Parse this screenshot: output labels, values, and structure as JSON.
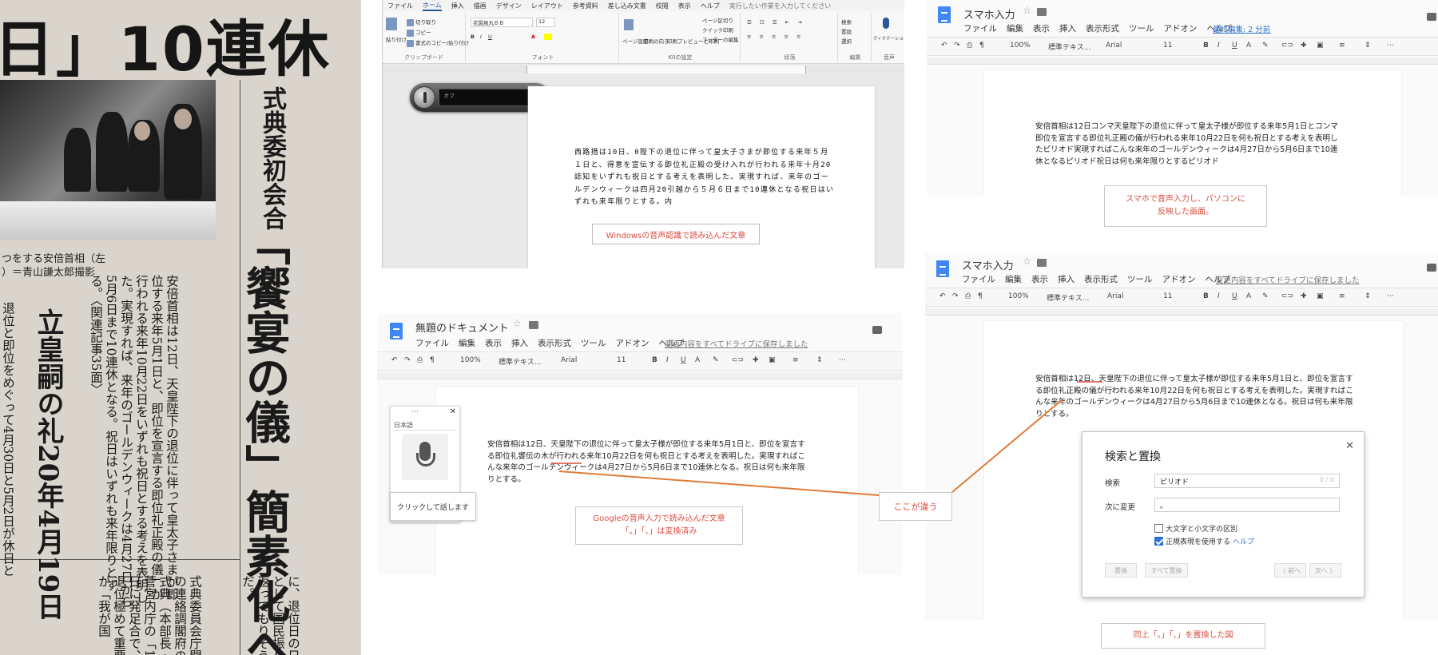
{
  "newspaper": {
    "headline": "日」10連休",
    "subheadline": "式典委初会合",
    "big_headline": "「饗宴の儀」簡素化へ",
    "section_label": "立皇嗣の礼20年4月19日",
    "photo_caption": "つをする安倍首相（左\n）＝青山謙太郎撮影",
    "body_text_a": "安倍首相は12日、天皇陛下の退位に伴って皇太子さまが即位する来年5月1日と、即位を宣言する即位礼正殿の儀」が行われる来年10月22日をいずれも祝日とする考えを表明した。実現すれば、来年のゴールデンウィークは4月27日から5月6日まで10連休となる。祝日はいずれも来年限りとする。〈関連記事35面〉",
    "body_text_b": "退位と即位をめぐって4月30日と5月2日が休日と",
    "body_text_c": "式典委員会庁間の連絡調閣府の式典（本部長・菅宮内庁の「12日に発足合で、退位極めて重要が「我が国",
    "body_text_d": "に、退位日の日として国民振り返ってもりそうだ。"
  },
  "word": {
    "menu": [
      "ファイル",
      "ホーム",
      "挿入",
      "描画",
      "デザイン",
      "レイアウト",
      "参考資料",
      "差し込み文書",
      "校閲",
      "表示",
      "ヘルプ",
      "実行したい作業を入力してください"
    ],
    "active_tab": "ホーム",
    "ribbon": {
      "clipboard": {
        "paste": "貼り付け",
        "cut": "切り取り",
        "copy": "コピー",
        "format": "書式のコピー/貼り付け",
        "label": "クリップボード"
      },
      "font": {
        "name": "花園風丸ＢＢ",
        "size": "12",
        "label": "フォント"
      },
      "kx": {
        "page_settings": "ページ設定",
        "print_direction": "印刷の向き",
        "print_preview": "印刷プレビューと印刷",
        "label": "K0の設定"
      },
      "header_footer": {
        "page_break": "ページ区切り",
        "quick_print": "クイック印刷",
        "footer_edit": "フッターの編集"
      },
      "paragraph": {
        "label": "段落"
      },
      "editing": {
        "find": "検索",
        "replace": "置換",
        "select": "選択",
        "label": "編集"
      },
      "voice": {
        "dictation": "ディクテーション",
        "label": "音声"
      }
    },
    "voice_widget_text": "オフ",
    "document_text": "西路措は10日、0陛下の退位に伴って皇太子さまが即位する来年５月１日と、得意を宣伝する即位礼正殿の受け入れが行われる来年十月20誌知をいずれも祝日とする考えを表明した。実現すれば、来年のゴールデンウィークは四月20引越から５月６日まで10連休となる祝日はいずれも来年限りとする。内",
    "caption": "Windowsの音声認識で読み込んだ文章"
  },
  "gdoc_untitled": {
    "title": "無題のドキュメント",
    "menu": [
      "ファイル",
      "編集",
      "表示",
      "挿入",
      "表示形式",
      "ツール",
      "アドオン",
      "ヘルプ"
    ],
    "save_status": "変更内容をすべてドライブに保存しました",
    "toolbar": {
      "zoom": "100%",
      "style": "標準テキス...",
      "font": "Arial",
      "size": "11"
    },
    "voice_lang": "日本語",
    "voice_tip": "クリックして話します",
    "document_text": "安倍首相は12日、天皇陛下の退位に伴って皇太子様が即位する来年5月1日と、即位を宣言する即位礼饗伝の木が行われる来年10月22日を何も祝日とする考えを表明した。実現すればこんな来年のゴールデンウィークは4月27日から5月6日まで10連休となる。祝日は何も来年限りとする。",
    "caption_line1": "Googleの音声入力で読み込んだ文章",
    "caption_line2": "「。」「、」は変換済み"
  },
  "gdoc_phone1": {
    "title": "スマホ入力",
    "menu": [
      "ファイル",
      "編集",
      "表示",
      "挿入",
      "表示形式",
      "ツール",
      "アドオン",
      "ヘルプ"
    ],
    "save_status": "最終編集: 2 分前",
    "toolbar": {
      "zoom": "100%",
      "style": "標準テキス...",
      "font": "Arial",
      "size": "11"
    },
    "document_text": "安倍首相は12日コンマ天皇陛下の退位に伴って皇太子様が即位する来年5月1日とコンマ即位を宣言する即位礼正殿の儀が行われる来年10月22日を何も祝日とする考えを表明したピリオド実現すればこんな来年のゴールデンウィークは4月27日から5月6日まで10連休となるピリオド祝日は何も来年限りとするピリオド",
    "caption_line1": "スマホで音声入力し、パソコンに",
    "caption_line2": "反映した画面。"
  },
  "gdoc_phone2": {
    "title": "スマホ入力",
    "menu": [
      "ファイル",
      "編集",
      "表示",
      "挿入",
      "表示形式",
      "ツール",
      "アドオン",
      "ヘルプ"
    ],
    "save_status": "変更内容をすべてドライブに保存しました",
    "toolbar": {
      "zoom": "100%",
      "style": "標準テキス...",
      "font": "Arial",
      "size": "11"
    },
    "document_text": "安倍首相は12日、天皇陛下の退位に伴って皇太子様が即位する来年5月1日と、即位を宣言する即位礼正殿の儀が行われる来年10月22日を何も祝日とする考えを表明した。実現すればこんな来年のゴールデンウィークは4月27日から5月6日まで10連休となる。祝日は何も来年限りとする。",
    "find_replace": {
      "title": "検索と置換",
      "find_label": "検索",
      "find_value": "ピリオド",
      "find_count": "0 / 0",
      "replace_label": "次に変更",
      "replace_value": "。",
      "match_case": "大文字と小文字の区別",
      "use_regex": "正規表現を使用する",
      "help": "ヘルプ",
      "btn_replace": "置換",
      "btn_replace_all": "すべて置換",
      "btn_prev": "〈 前へ",
      "btn_next": "次へ 〉"
    },
    "caption": "同上「。」「、」を置換した図"
  },
  "callout": "ここが違う",
  "colors": {
    "caption_red": "#d84b3e",
    "arrow_orange": "#e07b39",
    "gdocs_blue": "#4285f4"
  }
}
